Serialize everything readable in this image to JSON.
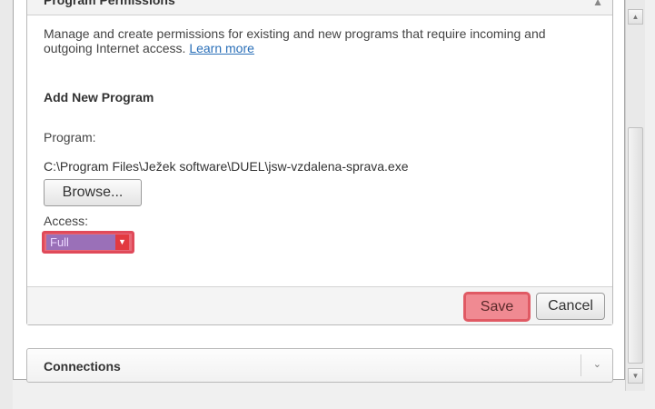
{
  "permissions_section": {
    "title": "Program Permissions",
    "description": "Manage and create permissions for existing and new programs that require incoming and outgoing Internet access.",
    "learn_more_label": "Learn more",
    "add_heading": "Add New Program",
    "program_label": "Program:",
    "program_path": "C:\\Program Files\\Ježek software\\DUEL\\jsw-vzdalena-sprava.exe",
    "browse_label": "Browse...",
    "access_label": "Access:",
    "access_value": "Full",
    "save_label": "Save",
    "cancel_label": "Cancel"
  },
  "connections_section": {
    "title": "Connections"
  },
  "icons": {
    "collapse": "chevron-up-icon",
    "expand": "chevron-down-icon",
    "dropdown": "caret-down-icon"
  },
  "colors": {
    "highlight_border": "#e04a5a",
    "save_bg": "#f08a92",
    "access_value_bg": "#9a70b8",
    "link": "#2a6fb8"
  }
}
